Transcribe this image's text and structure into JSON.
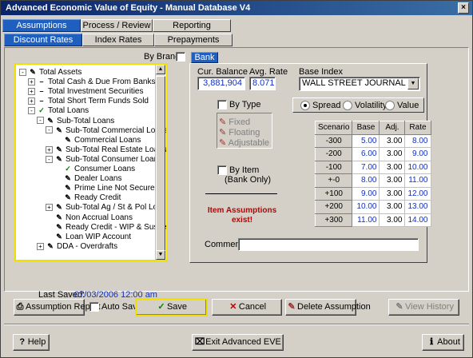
{
  "window": {
    "title": "Advanced Economic Value of Equity - Manual Database V4"
  },
  "tabs_top": [
    "Assumptions",
    "Process / Review",
    "Reporting"
  ],
  "tabs_sub": [
    "Discount Rates",
    "Index Rates",
    "Prepayments"
  ],
  "by_branch": "By Branch",
  "tree": [
    {
      "label": "Total Assets",
      "icon": "✎",
      "exp": "-"
    },
    {
      "label": "Total Cash & Due From Banks",
      "exp": "+",
      "dash": true
    },
    {
      "label": "Total Investment Securities",
      "exp": "+",
      "dash": true
    },
    {
      "label": "Total Short Term Funds Sold",
      "exp": "+",
      "dash": true
    },
    {
      "label": "Total Loans",
      "icon": "✓",
      "exp": "-"
    },
    {
      "label": "Sub-Total Loans",
      "icon": "✎",
      "exp": "-"
    },
    {
      "label": "Sub-Total Commercial Loans",
      "icon": "✎",
      "exp": "-"
    },
    {
      "label": "Commercial Loans",
      "icon": "✎"
    },
    {
      "label": "Sub-Total Real Estate Loans",
      "icon": "✎",
      "exp": "+"
    },
    {
      "label": "Sub-Total Consumer Loans",
      "icon": "✎",
      "exp": "-"
    },
    {
      "label": "Consumer Loans",
      "icon": "✓"
    },
    {
      "label": "Dealer Loans",
      "icon": "✎"
    },
    {
      "label": "Prime Line Not Secured I",
      "icon": "✎"
    },
    {
      "label": "Ready Credit",
      "icon": "✎"
    },
    {
      "label": "Sub-Total Ag / St & Pol Loar",
      "icon": "✎",
      "exp": "+"
    },
    {
      "label": "Non Accrual Loans",
      "icon": "✎"
    },
    {
      "label": "Ready Credit - WIP & Suspe",
      "icon": "✎"
    },
    {
      "label": "Loan WIP Account",
      "icon": "✎"
    },
    {
      "label": "DDA - Overdrafts",
      "icon": "✎",
      "exp": "+"
    }
  ],
  "bank_tab": "Bank",
  "cur_balance": {
    "label": "Cur. Balance",
    "value": "3,881,904"
  },
  "avg_rate": {
    "label": "Avg. Rate",
    "value": "8.071"
  },
  "base_index": {
    "label": "Base Index",
    "value": "WALL STREET JOURNAL"
  },
  "by_type": "By Type",
  "type_options": [
    "Fixed",
    "Floating",
    "Adjustable"
  ],
  "radios": [
    "Spread",
    "Volatility",
    "Value"
  ],
  "by_item": "By Item",
  "bank_only": "(Bank Only)",
  "item_msg": [
    "Item Assumptions",
    "exist!"
  ],
  "table": {
    "headers": [
      "Scenario",
      "Base",
      "Adj.",
      "Rate"
    ],
    "rows": [
      [
        "-300",
        "5.00",
        "3.00",
        "8.00"
      ],
      [
        "-200",
        "6.00",
        "3.00",
        "9.00"
      ],
      [
        "-100",
        "7.00",
        "3.00",
        "10.00"
      ],
      [
        "+-0",
        "8.00",
        "3.00",
        "11.00"
      ],
      [
        "+100",
        "9.00",
        "3.00",
        "12.00"
      ],
      [
        "+200",
        "10.00",
        "3.00",
        "13.00"
      ],
      [
        "+300",
        "11.00",
        "3.00",
        "14.00"
      ]
    ]
  },
  "comment_label": "Comment:",
  "last_saved": {
    "label": "Last Saved:",
    "value": "07/03/2006 12:00 am"
  },
  "buttons": {
    "assumption_report": "Assumption Report",
    "auto_save": "Auto Save",
    "save": "Save",
    "cancel": "Cancel",
    "delete": "Delete Assumption",
    "view_history": "View History",
    "help": "Help",
    "exit": "Exit Advanced EVE",
    "about": "About"
  }
}
